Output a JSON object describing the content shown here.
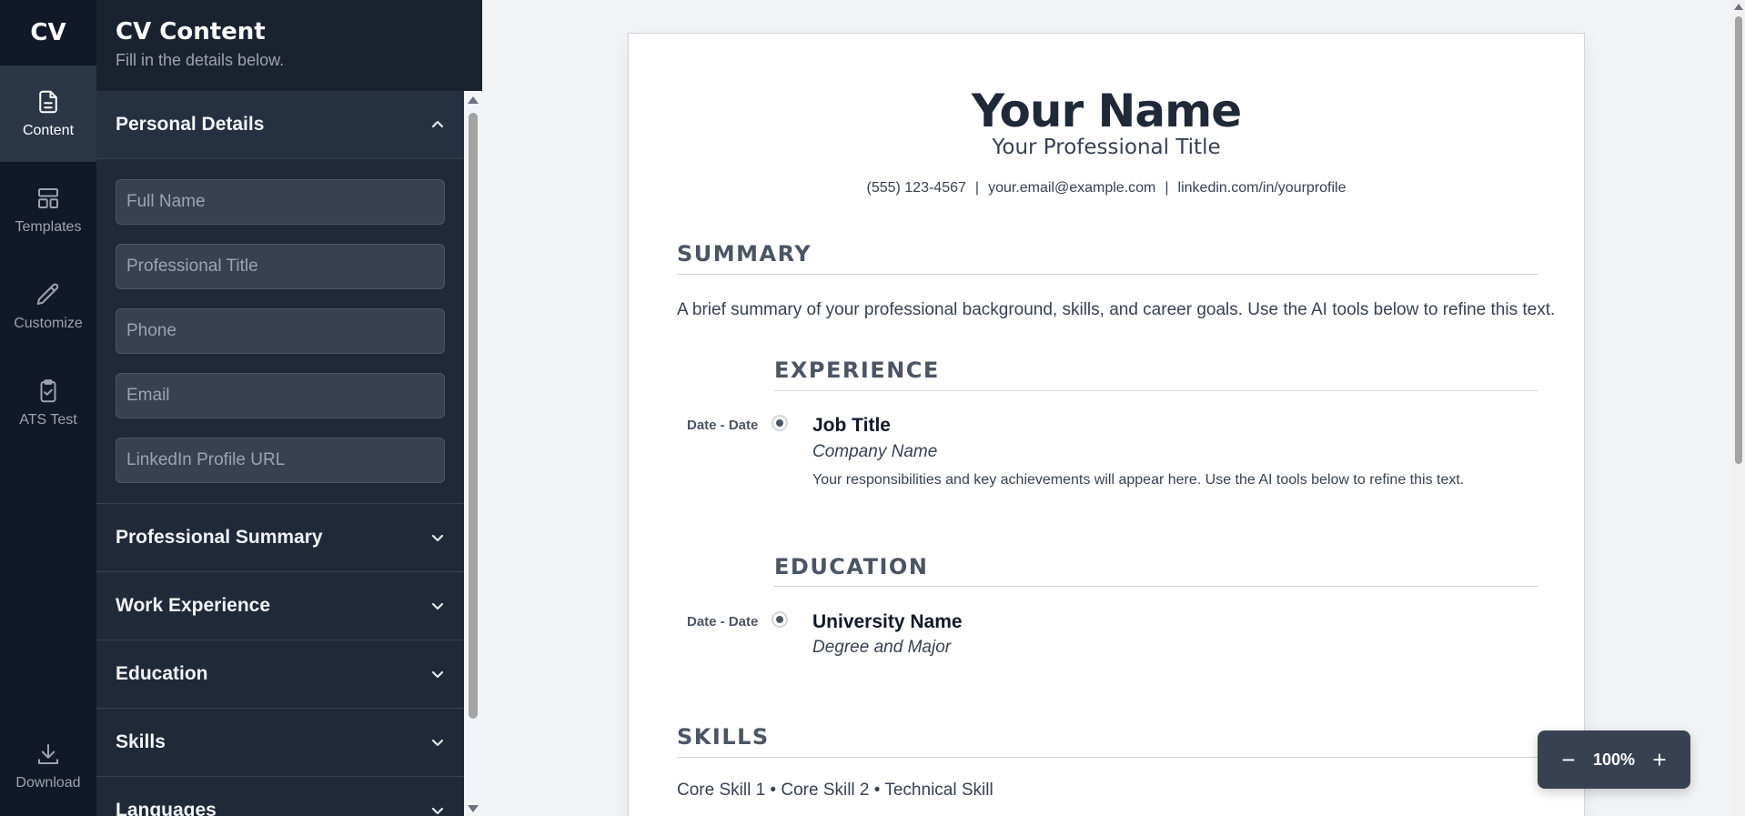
{
  "rail": {
    "logo": "CV",
    "items": [
      {
        "label": "Content",
        "icon": "document-icon",
        "active": true
      },
      {
        "label": "Templates",
        "icon": "layout-icon",
        "active": false
      },
      {
        "label": "Customize",
        "icon": "pencil-icon",
        "active": false
      },
      {
        "label": "ATS Test",
        "icon": "clipboard-check-icon",
        "active": false
      }
    ],
    "download": {
      "label": "Download",
      "icon": "download-icon"
    }
  },
  "panel": {
    "title": "CV Content",
    "subtitle": "Fill in the details below.",
    "sections": [
      {
        "label": "Personal Details",
        "expanded": true
      },
      {
        "label": "Professional Summary",
        "expanded": false
      },
      {
        "label": "Work Experience",
        "expanded": false
      },
      {
        "label": "Education",
        "expanded": false
      },
      {
        "label": "Skills",
        "expanded": false
      },
      {
        "label": "Languages",
        "expanded": false
      }
    ],
    "personal_fields": [
      {
        "placeholder": "Full Name",
        "value": ""
      },
      {
        "placeholder": "Professional Title",
        "value": ""
      },
      {
        "placeholder": "Phone",
        "value": ""
      },
      {
        "placeholder": "Email",
        "value": ""
      },
      {
        "placeholder": "LinkedIn Profile URL",
        "value": ""
      }
    ]
  },
  "resume": {
    "name": "Your Name",
    "title": "Your Professional Title",
    "phone": "(555) 123-4567",
    "email": "your.email@example.com",
    "linkedin": "linkedin.com/in/yourprofile",
    "separator": "|",
    "summary_heading": "SUMMARY",
    "summary_text": "A brief summary of your professional background, skills, and career goals. Use the AI tools below to refine this text.",
    "experience_heading": "EXPERIENCE",
    "experience": {
      "date": "Date - Date",
      "title": "Job Title",
      "company": "Company Name",
      "description": "Your responsibilities and key achievements will appear here. Use the AI tools below to refine this text."
    },
    "education_heading": "EDUCATION",
    "education": {
      "date": "Date - Date",
      "school": "University Name",
      "degree": "Degree and Major"
    },
    "skills_heading": "SKILLS",
    "skills_text": "Core Skill 1 • Core Skill 2 • Technical Skill"
  },
  "zoom": {
    "minus": "−",
    "value": "100%",
    "plus": "+"
  }
}
